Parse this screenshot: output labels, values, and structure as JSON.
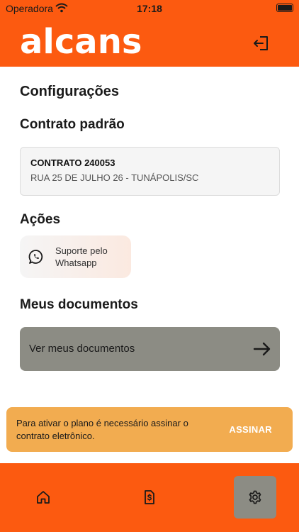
{
  "status_bar": {
    "carrier": "Operadora",
    "time": "17:18",
    "icons": [
      "wifi-icon",
      "battery-icon"
    ]
  },
  "header": {
    "logo_text": "alcans",
    "logout_icon": "logout-icon"
  },
  "page": {
    "title": "Configurações"
  },
  "contract": {
    "section_title": "Contrato padrão",
    "name": "CONTRATO 240053",
    "address": "RUA 25 DE JULHO 26 - TUNÁPOLIS/SC"
  },
  "actions": {
    "section_title": "Ações",
    "support_label": "Suporte pelo Whatsapp",
    "support_icon": "whatsapp-icon"
  },
  "documents": {
    "section_title": "Meus documentos",
    "button_label": "Ver meus documentos",
    "button_icon": "arrow-right-icon"
  },
  "banner": {
    "message": "Para ativar o plano é necessário assinar o contrato eletrônico.",
    "action_label": "ASSINAR"
  },
  "bottom_nav": {
    "items": [
      {
        "icon": "home-icon",
        "active": false
      },
      {
        "icon": "bill-icon",
        "active": false
      },
      {
        "icon": "gear-icon",
        "active": true
      }
    ]
  },
  "colors": {
    "brand": "#fc5a10",
    "card_gray": "#8c8c84",
    "banner": "#f2ac50"
  }
}
